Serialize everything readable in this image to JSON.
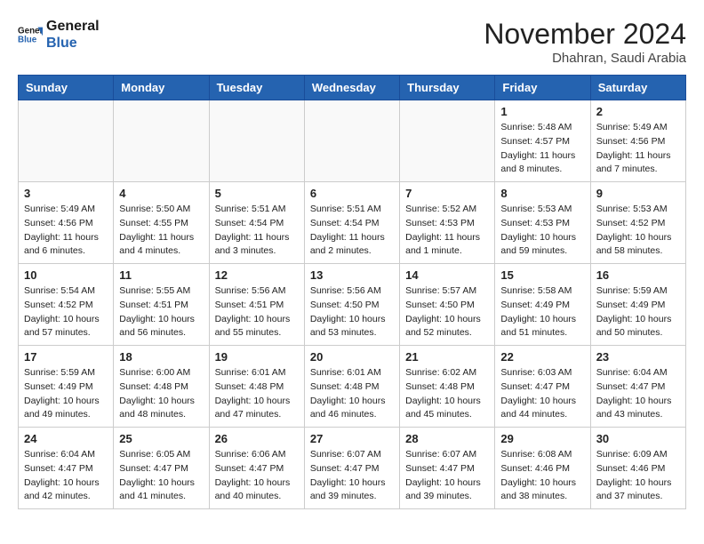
{
  "header": {
    "logo_line1": "General",
    "logo_line2": "Blue",
    "month_title": "November 2024",
    "location": "Dhahran, Saudi Arabia"
  },
  "days_of_week": [
    "Sunday",
    "Monday",
    "Tuesday",
    "Wednesday",
    "Thursday",
    "Friday",
    "Saturday"
  ],
  "weeks": [
    [
      {
        "day": "",
        "info": ""
      },
      {
        "day": "",
        "info": ""
      },
      {
        "day": "",
        "info": ""
      },
      {
        "day": "",
        "info": ""
      },
      {
        "day": "",
        "info": ""
      },
      {
        "day": "1",
        "info": "Sunrise: 5:48 AM\nSunset: 4:57 PM\nDaylight: 11 hours and 8 minutes."
      },
      {
        "day": "2",
        "info": "Sunrise: 5:49 AM\nSunset: 4:56 PM\nDaylight: 11 hours and 7 minutes."
      }
    ],
    [
      {
        "day": "3",
        "info": "Sunrise: 5:49 AM\nSunset: 4:56 PM\nDaylight: 11 hours and 6 minutes."
      },
      {
        "day": "4",
        "info": "Sunrise: 5:50 AM\nSunset: 4:55 PM\nDaylight: 11 hours and 4 minutes."
      },
      {
        "day": "5",
        "info": "Sunrise: 5:51 AM\nSunset: 4:54 PM\nDaylight: 11 hours and 3 minutes."
      },
      {
        "day": "6",
        "info": "Sunrise: 5:51 AM\nSunset: 4:54 PM\nDaylight: 11 hours and 2 minutes."
      },
      {
        "day": "7",
        "info": "Sunrise: 5:52 AM\nSunset: 4:53 PM\nDaylight: 11 hours and 1 minute."
      },
      {
        "day": "8",
        "info": "Sunrise: 5:53 AM\nSunset: 4:53 PM\nDaylight: 10 hours and 59 minutes."
      },
      {
        "day": "9",
        "info": "Sunrise: 5:53 AM\nSunset: 4:52 PM\nDaylight: 10 hours and 58 minutes."
      }
    ],
    [
      {
        "day": "10",
        "info": "Sunrise: 5:54 AM\nSunset: 4:52 PM\nDaylight: 10 hours and 57 minutes."
      },
      {
        "day": "11",
        "info": "Sunrise: 5:55 AM\nSunset: 4:51 PM\nDaylight: 10 hours and 56 minutes."
      },
      {
        "day": "12",
        "info": "Sunrise: 5:56 AM\nSunset: 4:51 PM\nDaylight: 10 hours and 55 minutes."
      },
      {
        "day": "13",
        "info": "Sunrise: 5:56 AM\nSunset: 4:50 PM\nDaylight: 10 hours and 53 minutes."
      },
      {
        "day": "14",
        "info": "Sunrise: 5:57 AM\nSunset: 4:50 PM\nDaylight: 10 hours and 52 minutes."
      },
      {
        "day": "15",
        "info": "Sunrise: 5:58 AM\nSunset: 4:49 PM\nDaylight: 10 hours and 51 minutes."
      },
      {
        "day": "16",
        "info": "Sunrise: 5:59 AM\nSunset: 4:49 PM\nDaylight: 10 hours and 50 minutes."
      }
    ],
    [
      {
        "day": "17",
        "info": "Sunrise: 5:59 AM\nSunset: 4:49 PM\nDaylight: 10 hours and 49 minutes."
      },
      {
        "day": "18",
        "info": "Sunrise: 6:00 AM\nSunset: 4:48 PM\nDaylight: 10 hours and 48 minutes."
      },
      {
        "day": "19",
        "info": "Sunrise: 6:01 AM\nSunset: 4:48 PM\nDaylight: 10 hours and 47 minutes."
      },
      {
        "day": "20",
        "info": "Sunrise: 6:01 AM\nSunset: 4:48 PM\nDaylight: 10 hours and 46 minutes."
      },
      {
        "day": "21",
        "info": "Sunrise: 6:02 AM\nSunset: 4:48 PM\nDaylight: 10 hours and 45 minutes."
      },
      {
        "day": "22",
        "info": "Sunrise: 6:03 AM\nSunset: 4:47 PM\nDaylight: 10 hours and 44 minutes."
      },
      {
        "day": "23",
        "info": "Sunrise: 6:04 AM\nSunset: 4:47 PM\nDaylight: 10 hours and 43 minutes."
      }
    ],
    [
      {
        "day": "24",
        "info": "Sunrise: 6:04 AM\nSunset: 4:47 PM\nDaylight: 10 hours and 42 minutes."
      },
      {
        "day": "25",
        "info": "Sunrise: 6:05 AM\nSunset: 4:47 PM\nDaylight: 10 hours and 41 minutes."
      },
      {
        "day": "26",
        "info": "Sunrise: 6:06 AM\nSunset: 4:47 PM\nDaylight: 10 hours and 40 minutes."
      },
      {
        "day": "27",
        "info": "Sunrise: 6:07 AM\nSunset: 4:47 PM\nDaylight: 10 hours and 39 minutes."
      },
      {
        "day": "28",
        "info": "Sunrise: 6:07 AM\nSunset: 4:47 PM\nDaylight: 10 hours and 39 minutes."
      },
      {
        "day": "29",
        "info": "Sunrise: 6:08 AM\nSunset: 4:46 PM\nDaylight: 10 hours and 38 minutes."
      },
      {
        "day": "30",
        "info": "Sunrise: 6:09 AM\nSunset: 4:46 PM\nDaylight: 10 hours and 37 minutes."
      }
    ]
  ]
}
